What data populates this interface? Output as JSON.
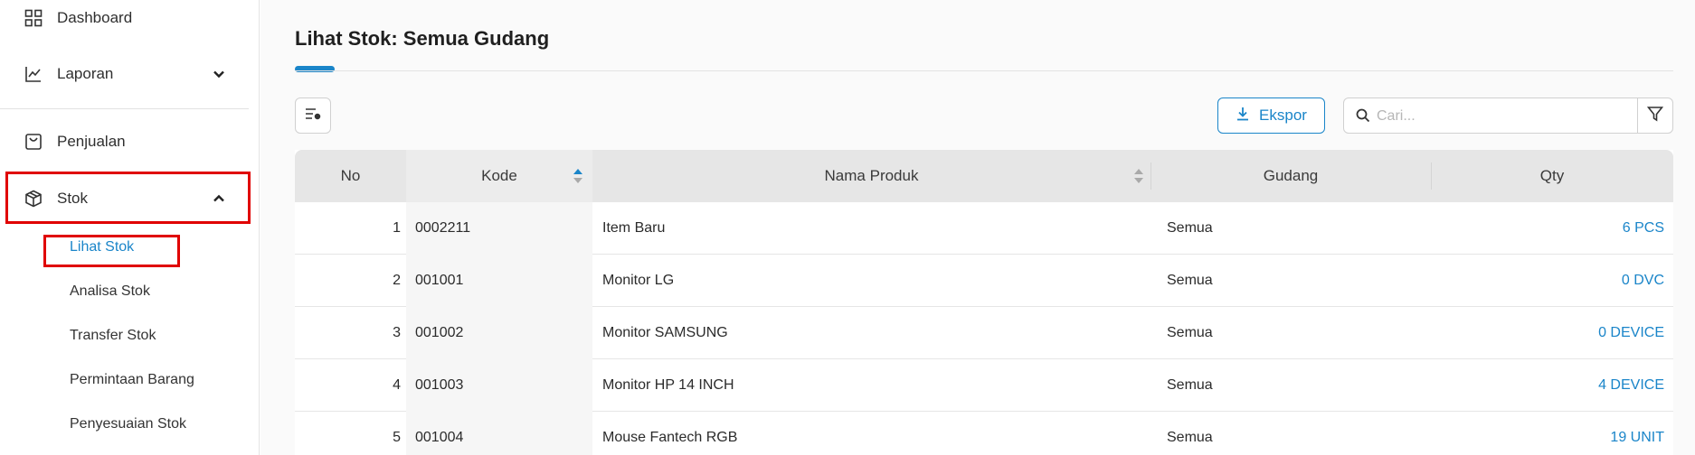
{
  "sidebar": {
    "items": [
      {
        "label": "Dashboard",
        "icon": "grid-icon"
      },
      {
        "label": "Laporan",
        "icon": "chart-line-icon"
      },
      {
        "label": "Penjualan",
        "icon": "bag-icon"
      },
      {
        "label": "Stok",
        "icon": "box-icon"
      }
    ],
    "submenu": [
      {
        "label": "Lihat Stok"
      },
      {
        "label": "Analisa Stok"
      },
      {
        "label": "Transfer Stok"
      },
      {
        "label": "Permintaan Barang"
      },
      {
        "label": "Penyesuaian Stok"
      }
    ]
  },
  "main": {
    "title": "Lihat Stok: Semua Gudang",
    "export_label": "Ekspor",
    "search_placeholder": "Cari..."
  },
  "table": {
    "headers": {
      "no": "No",
      "kode": "Kode",
      "nama": "Nama Produk",
      "gudang": "Gudang",
      "qty": "Qty"
    },
    "rows": [
      {
        "no": "1",
        "kode": "0002211",
        "nama": "Item Baru",
        "gudang": "Semua",
        "qty": "6 PCS"
      },
      {
        "no": "2",
        "kode": "001001",
        "nama": "Monitor LG",
        "gudang": "Semua",
        "qty": "0 DVC"
      },
      {
        "no": "3",
        "kode": "001002",
        "nama": "Monitor SAMSUNG",
        "gudang": "Semua",
        "qty": "0 DEVICE"
      },
      {
        "no": "4",
        "kode": "001003",
        "nama": "Monitor HP 14 INCH",
        "gudang": "Semua",
        "qty": "4 DEVICE"
      },
      {
        "no": "5",
        "kode": "001004",
        "nama": "Mouse Fantech RGB",
        "gudang": "Semua",
        "qty": "19 UNIT"
      }
    ]
  },
  "colors": {
    "accent": "#1a85c9",
    "highlight_box": "#e00000",
    "header_bg": "#e6e6e6"
  }
}
